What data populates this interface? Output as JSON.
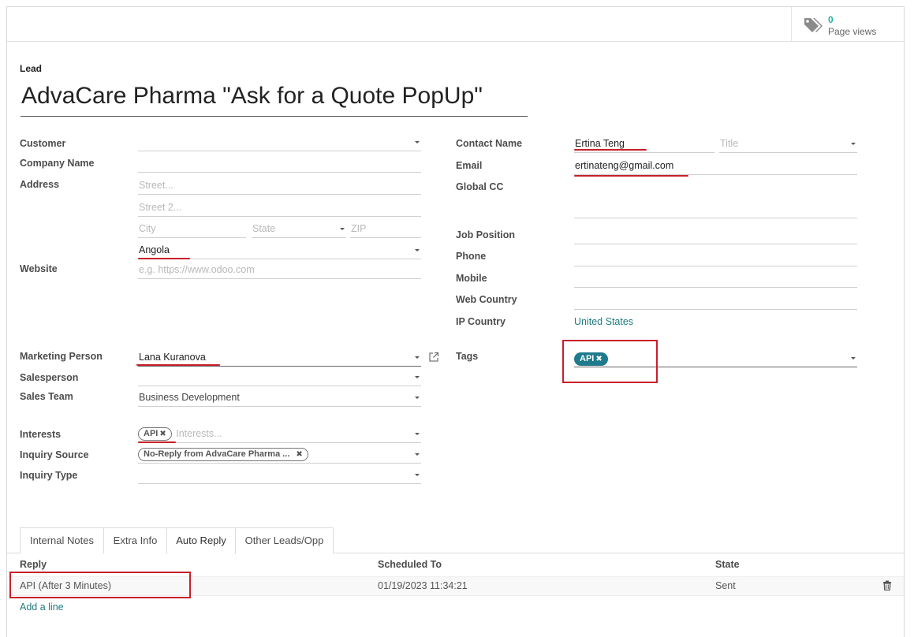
{
  "stat": {
    "value": "0",
    "label": "Page views",
    "icon": "tags-icon"
  },
  "header": {
    "record_type": "Lead",
    "title": "AdvaCare Pharma \"Ask for a Quote PopUp\""
  },
  "left": {
    "customer_label": "Customer",
    "company_label": "Company Name",
    "address_label": "Address",
    "street_placeholder": "Street...",
    "street2_placeholder": "Street 2...",
    "city_placeholder": "City",
    "state_placeholder": "State",
    "zip_placeholder": "ZIP",
    "country_value": "Angola",
    "website_label": "Website",
    "website_placeholder": "e.g. https://www.odoo.com",
    "marketing_label": "Marketing Person",
    "marketing_value": "Lana Kuranova",
    "salesperson_label": "Salesperson",
    "salesteam_label": "Sales Team",
    "salesteam_value": "Business Development",
    "interests_label": "Interests",
    "interests_tag": "API",
    "interests_placeholder": "Interests...",
    "inquiry_source_label": "Inquiry Source",
    "inquiry_source_tag": "No-Reply from AdvaCare Pharma ...",
    "inquiry_type_label": "Inquiry Type"
  },
  "right": {
    "contact_label": "Contact Name",
    "contact_value": "Ertina Teng",
    "title_placeholder": "Title",
    "email_label": "Email",
    "email_value": "ertinateng@gmail.com",
    "global_cc_label": "Global CC",
    "job_label": "Job Position",
    "phone_label": "Phone",
    "mobile_label": "Mobile",
    "web_country_label": "Web Country",
    "ip_country_label": "IP Country",
    "ip_country_value": "United States",
    "tags_label": "Tags",
    "tags_tag": "API"
  },
  "tabs": [
    "Internal Notes",
    "Extra Info",
    "Auto Reply",
    "Other Leads/Opp"
  ],
  "table": {
    "headers": [
      "Reply",
      "Scheduled To",
      "State"
    ],
    "rows": [
      {
        "reply": "API (After 3 Minutes)",
        "scheduled": "01/19/2023 11:34:21",
        "state": "Sent"
      }
    ],
    "add_line": "Add a line"
  },
  "colors": {
    "accent": "#1f7a8c",
    "stat_green": "#21b799",
    "annotation_red": "#c8202a"
  }
}
